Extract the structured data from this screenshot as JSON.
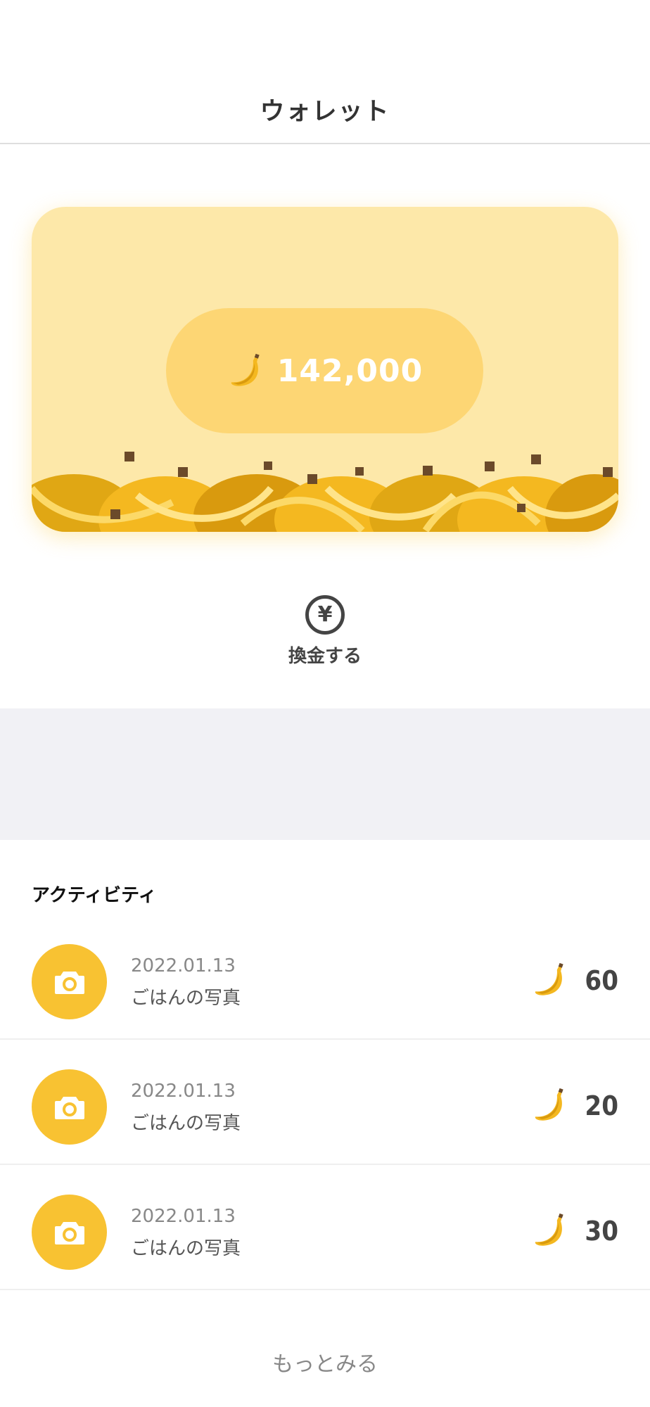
{
  "header": {
    "title": "ウォレット"
  },
  "wallet": {
    "balance": "142,000",
    "icon": "banana-icon",
    "colors": {
      "card": "#fde8a9",
      "pill": "#fdd674"
    }
  },
  "exchange": {
    "label": "換金する",
    "icon": "yen-icon"
  },
  "activity": {
    "title": "アクティビティ",
    "items": [
      {
        "date": "2022.01.13",
        "title": "ごはんの写真",
        "amount": "60",
        "icon": "camera-icon"
      },
      {
        "date": "2022.01.13",
        "title": "ごはんの写真",
        "amount": "20",
        "icon": "camera-icon"
      },
      {
        "date": "2022.01.13",
        "title": "ごはんの写真",
        "amount": "30",
        "icon": "camera-icon"
      }
    ],
    "accent_color": "#f8c232"
  },
  "more": {
    "label": "もっとみる"
  }
}
